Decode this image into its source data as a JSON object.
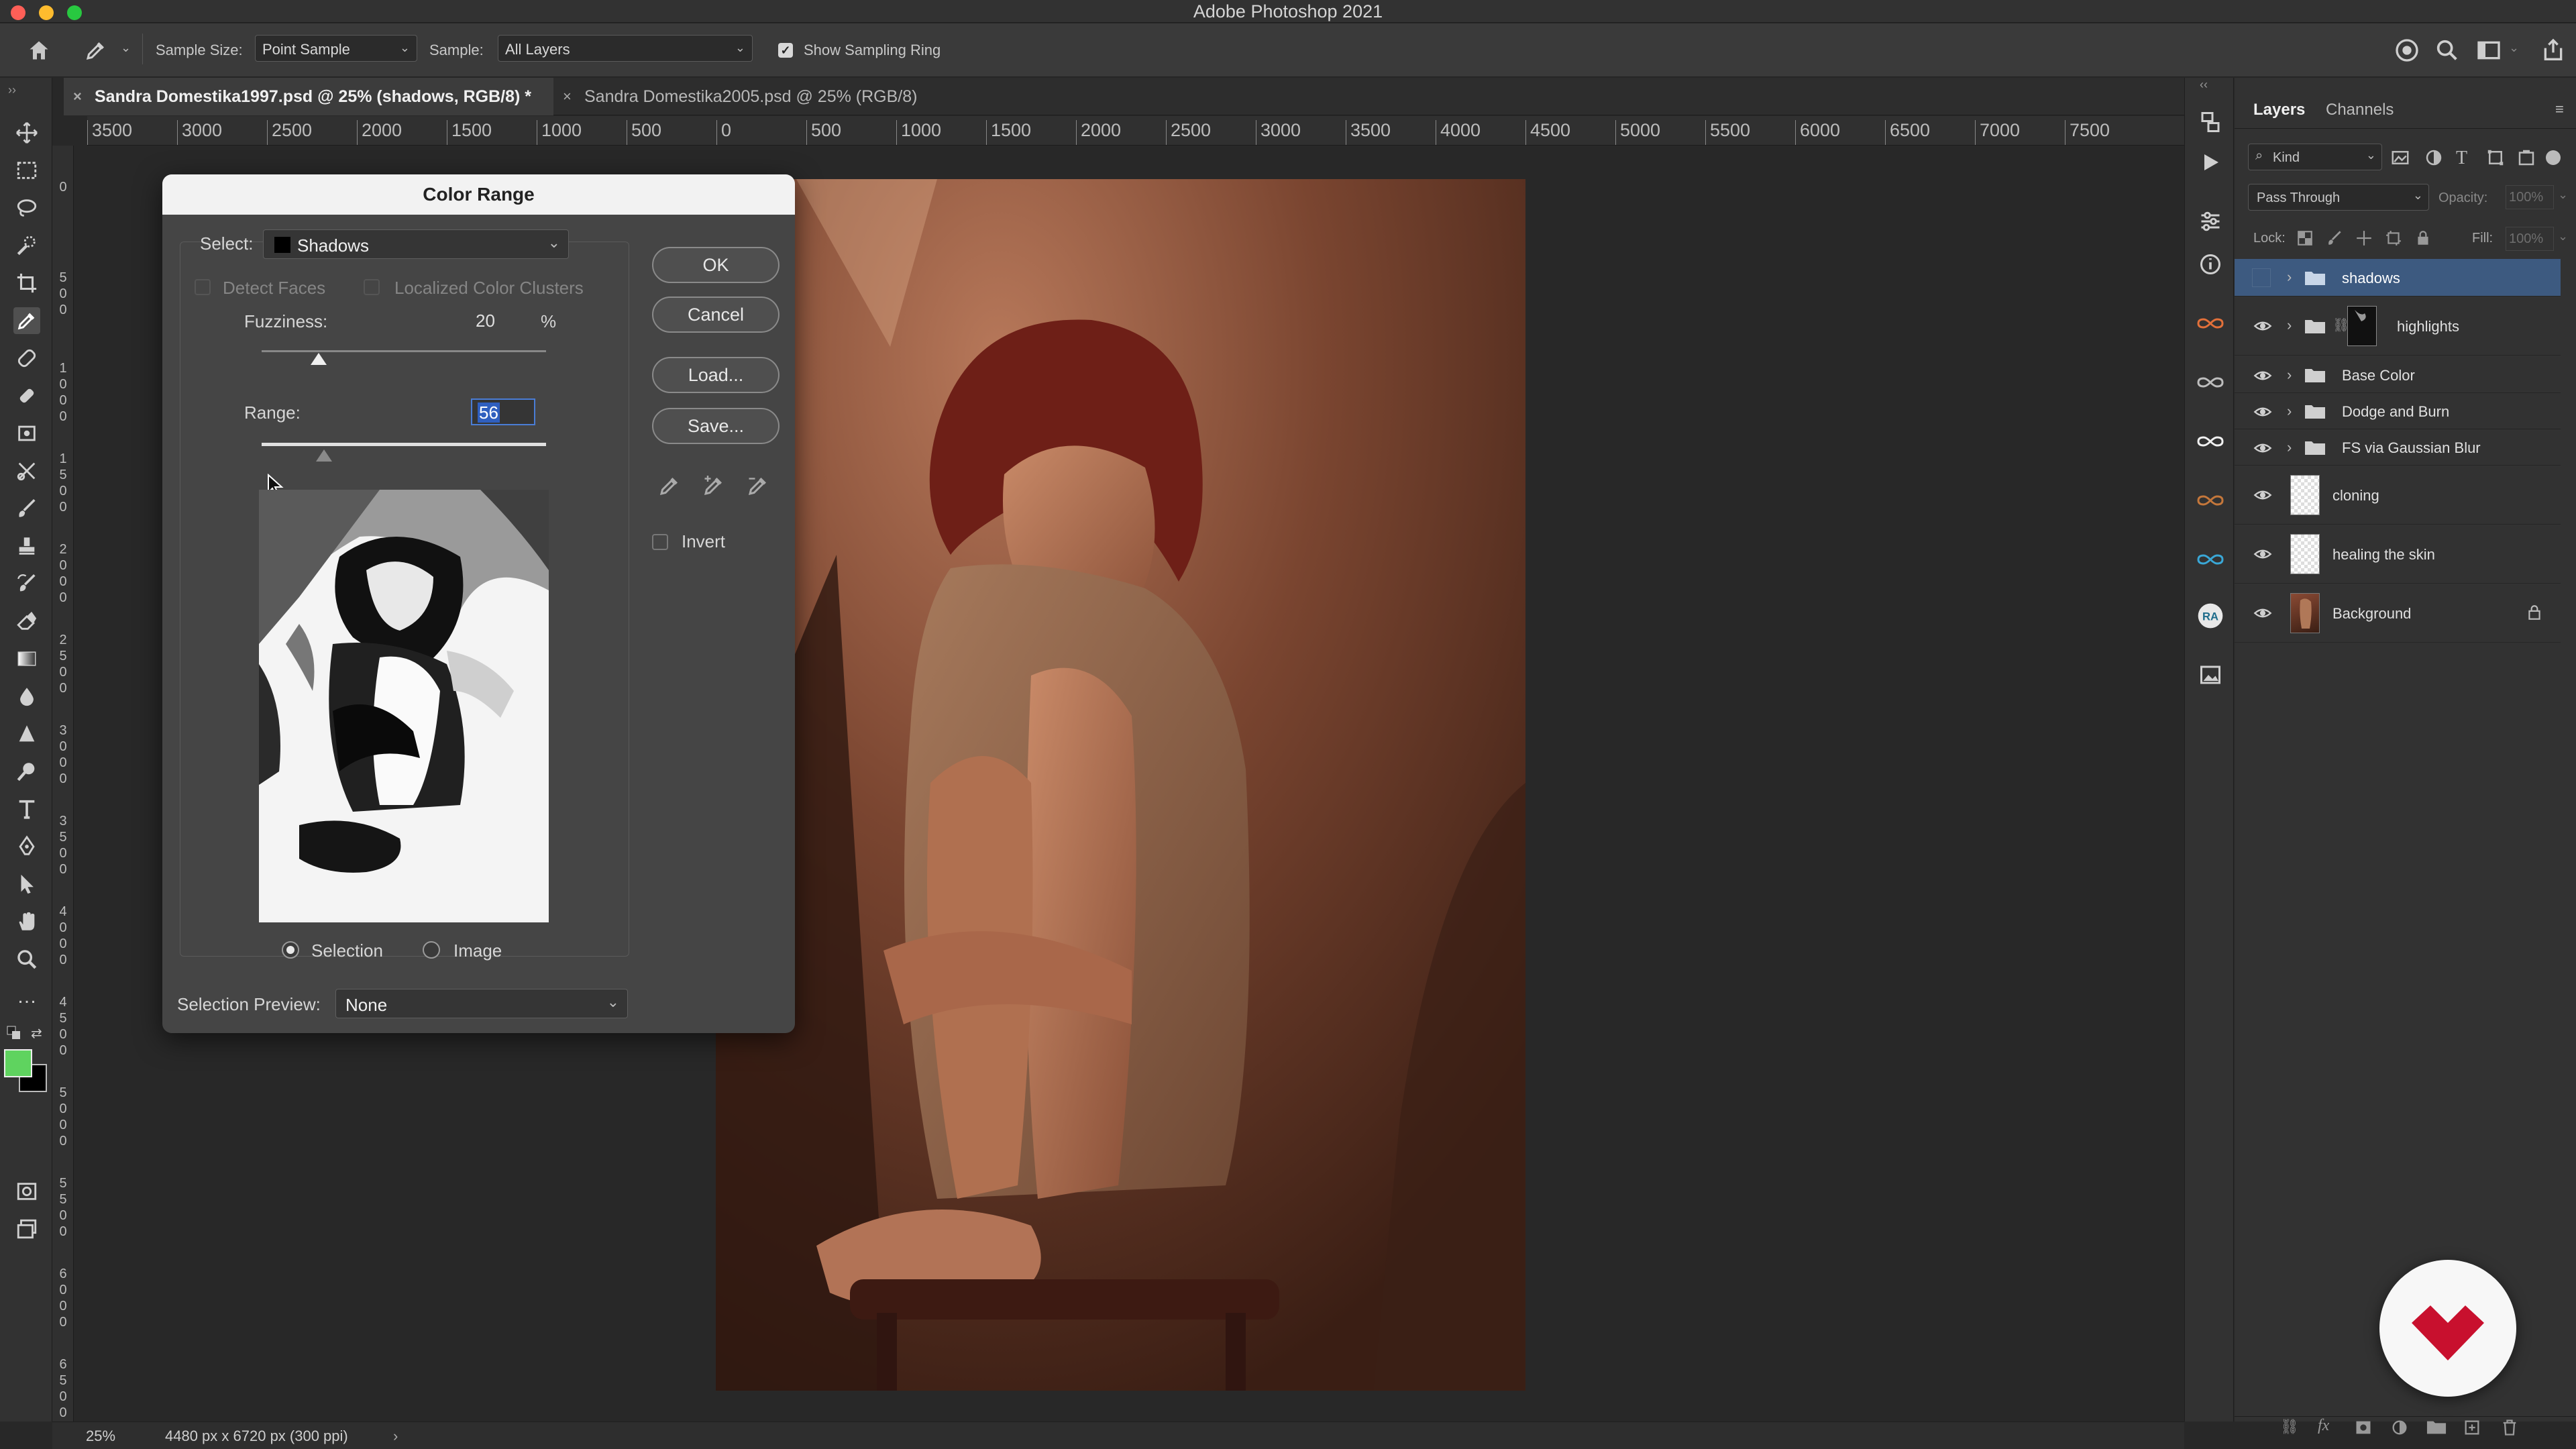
{
  "app": {
    "title": "Adobe Photoshop 2021"
  },
  "options_bar": {
    "sample_size_label": "Sample Size:",
    "sample_size_value": "Point Sample",
    "sample_label": "Sample:",
    "sample_value": "All Layers",
    "sampling_ring_label": "Show Sampling Ring",
    "sampling_ring_checked": true
  },
  "tabs": [
    {
      "label": "Sandra Domestika1997.psd @ 25% (shadows, RGB/8) *",
      "active": true
    },
    {
      "label": "Sandra Domestika2005.psd @ 25% (RGB/8)",
      "active": false
    }
  ],
  "ruler": {
    "horizontal": [
      "3500",
      "3000",
      "2500",
      "2000",
      "1500",
      "1000",
      "500",
      "0",
      "500",
      "1000",
      "1500",
      "2000",
      "2500",
      "3000",
      "3500",
      "4000",
      "4500",
      "5000",
      "5500",
      "6000",
      "6500",
      "7000",
      "7500"
    ],
    "vertical": [
      "0",
      "5 0 0",
      "1 0 0 0",
      "1 5 0 0",
      "2 0 0 0",
      "2 5 0 0",
      "3 0 0 0",
      "3 5 0 0",
      "4 0 0 0",
      "4 5 0 0",
      "5 0 0 0",
      "5 5 0 0",
      "6 0 0 0",
      "6 5 0 0"
    ]
  },
  "color_range_dialog": {
    "title": "Color Range",
    "select_label": "Select:",
    "select_value": "Shadows",
    "detect_faces_label": "Detect Faces",
    "localized_clusters_label": "Localized Color Clusters",
    "fuzziness_label": "Fuzziness:",
    "fuzziness_value": "20",
    "fuzziness_unit": "%",
    "fuzziness_level": 0.2,
    "range_label": "Range:",
    "range_value": "56",
    "range_level": 0.22,
    "selection_radio_label": "Selection",
    "image_radio_label": "Image",
    "selection_preview_label": "Selection Preview:",
    "selection_preview_value": "None",
    "ok_label": "OK",
    "cancel_label": "Cancel",
    "load_label": "Load...",
    "save_label": "Save...",
    "invert_label": "Invert"
  },
  "layers_panel": {
    "tabs": [
      "Layers",
      "Channels"
    ],
    "kind_filter": "Kind",
    "blend_mode": "Pass Through",
    "opacity_label": "Opacity:",
    "opacity_value": "100%",
    "lock_label": "Lock:",
    "fill_label": "Fill:",
    "fill_value": "100%",
    "layers": [
      {
        "name": "shadows",
        "type": "group",
        "selected": true,
        "visible": false
      },
      {
        "name": "highlights",
        "type": "group-mask",
        "selected": false,
        "visible": true
      },
      {
        "name": "Base Color",
        "type": "group",
        "selected": false,
        "visible": true
      },
      {
        "name": "Dodge and Burn",
        "type": "group",
        "selected": false,
        "visible": true
      },
      {
        "name": "FS via Gaussian Blur",
        "type": "group",
        "selected": false,
        "visible": true
      },
      {
        "name": "cloning",
        "type": "layer",
        "selected": false,
        "visible": true
      },
      {
        "name": "healing the skin",
        "type": "layer",
        "selected": false,
        "visible": true
      },
      {
        "name": "Background",
        "type": "background",
        "selected": false,
        "visible": true,
        "locked": true
      }
    ]
  },
  "status_bar": {
    "zoom": "25%",
    "doc_info": "4480 px x 6720 px (300 ppi)"
  },
  "colors": {
    "foreground": "#5fd35f",
    "background": "#000000",
    "accent_red": "#c8102e",
    "selected_layer": "#3d5a80"
  }
}
